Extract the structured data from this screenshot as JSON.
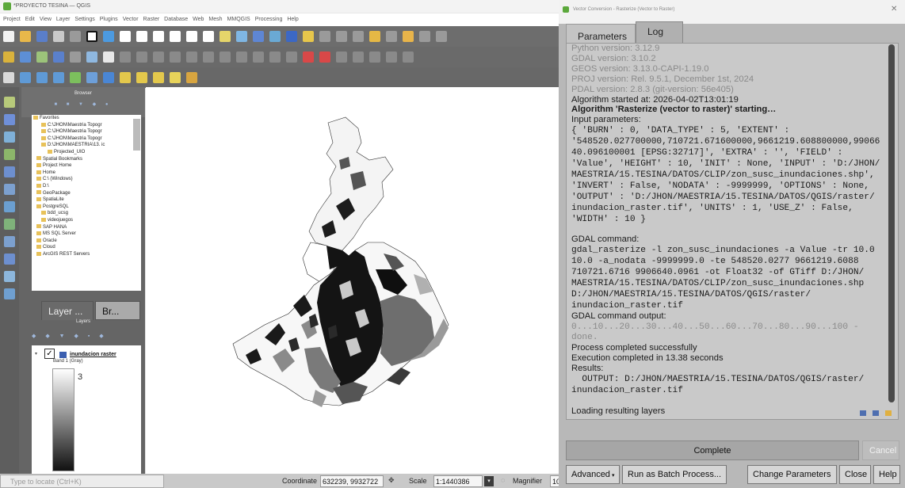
{
  "qgis": {
    "title": "*PROYECTO TESINA — QGIS",
    "menu": [
      "Project",
      "Edit",
      "View",
      "Layer",
      "Settings",
      "Plugins",
      "Vector",
      "Raster",
      "Database",
      "Web",
      "Mesh",
      "MMQGIS",
      "Processing",
      "Help"
    ]
  },
  "browser": {
    "title": "Browser",
    "items": [
      "Favorites",
      "C:\\JHON\\Maestria Topogr",
      "C:\\JHON\\Maestria Topogr",
      "C:\\JHON\\Maestria Topogr",
      "D:\\JHON\\MAESTRIA\\13. ic",
      "Projected_UIO",
      "Spatial Bookmarks",
      "Project Home",
      "Home",
      "C:\\ (Windows)",
      "D:\\",
      "GeoPackage",
      "SpatiaLite",
      "PostgreSQL",
      "bdd_ucsg",
      "videojuegos",
      "SAP HANA",
      "MS SQL Server",
      "Oracle",
      "Cloud",
      "ArcGIS REST Servers"
    ]
  },
  "panel_tabs": {
    "layers": "Layer ...",
    "browser": "Br..."
  },
  "layers": {
    "title": "Layers",
    "layer_name": "inundacion raster",
    "band": "Band 1 (Gray)",
    "legend_value": "3"
  },
  "status": {
    "locate_placeholder": "Type to locate (Ctrl+K)",
    "coordinate_label": "Coordinate",
    "coordinate_value": "632239, 9932722",
    "scale_label": "Scale",
    "scale_value": "1:1440386",
    "magnifier_label": "Magnifier",
    "magnifier_value": "10"
  },
  "dialog": {
    "title": "Vector Conversion - Rasterize (Vector to Raster)",
    "tab_parameters": "Parameters",
    "tab_log": "Log",
    "log": {
      "python": "Python version: 3.12.9",
      "gdal": "GDAL version: 3.10.2",
      "geos": "GEOS version: 3.13.0-CAPI-1.19.0",
      "proj": "PROJ version: Rel. 9.5.1, December 1st, 2024",
      "pdal": "PDAL version: 2.8.3 (git-version: 56e405)",
      "started": "Algorithm started at: 2026-04-02T13:01:19",
      "alg": "Algorithm 'Rasterize (vector to raster)' starting…",
      "input_label": "Input parameters:",
      "params": "{ 'BURN' : 0, 'DATA_TYPE' : 5, 'EXTENT' :\n'548520.027700000,710721.671600000,9661219.608800000,99066\n40.096100001 [EPSG:32717]', 'EXTRA' : '', 'FIELD' :\n'Value', 'HEIGHT' : 10, 'INIT' : None, 'INPUT' : 'D:/JHON/\nMAESTRIA/15.TESINA/DATOS/CLIP/zon_susc_inundaciones.shp',\n'INVERT' : False, 'NODATA' : -9999999, 'OPTIONS' : None,\n'OUTPUT' : 'D:/JHON/MAESTRIA/15.TESINA/DATOS/QGIS/raster/\ninundacion_raster.tif', 'UNITS' : 1, 'USE_Z' : False,\n'WIDTH' : 10 }",
      "gdal_cmd_label": "GDAL command:",
      "gdal_cmd": "gdal_rasterize -l zon_susc_inundaciones -a Value -tr 10.0\n10.0 -a_nodata -9999999.0 -te 548520.0277 9661219.6088\n710721.6716 9906640.0961 -ot Float32 -of GTiff D:/JHON/\nMAESTRIA/15.TESINA/DATOS/CLIP/zon_susc_inundaciones.shp\nD:/JHON/MAESTRIA/15.TESINA/DATOS/QGIS/raster/\ninundacion_raster.tif",
      "gdal_out_label": "GDAL command output:",
      "gdal_out": "0...10...20...30...40...50...60...70...80...90...100 -\ndone.",
      "success": "Process completed successfully",
      "exec": "Execution completed in 13.38 seconds",
      "results_label": "Results:",
      "results": "  OUTPUT: D:/JHON/MAESTRIA/15.TESINA/DATOS/QGIS/raster/\ninundacion_raster.tif",
      "loading": "Loading resulting layers"
    },
    "progress_label": "Complete",
    "progress": 1.0,
    "cancel_label": "Cancel",
    "advanced_label": "Advanced",
    "batch_label": "Run as Batch Process...",
    "change_label": "Change Parameters",
    "close_label": "Close",
    "help_label": "Help"
  }
}
